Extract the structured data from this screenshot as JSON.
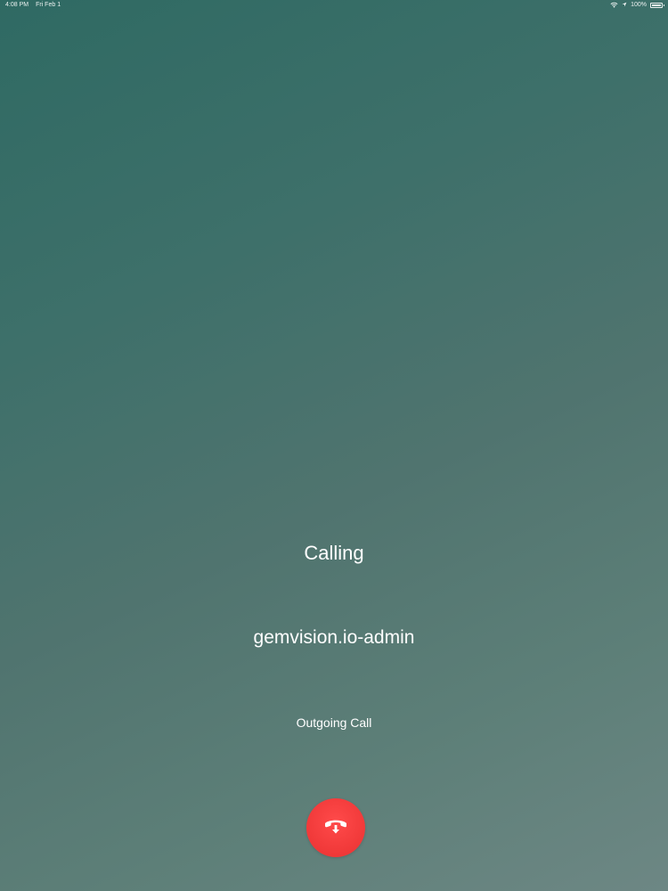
{
  "status_bar": {
    "time": "4:08 PM",
    "date": "Fri Feb 1",
    "battery_text": "100%",
    "battery_level": 1.0,
    "wifi_icon": "wifi-icon",
    "location_icon": "location-arrow-icon",
    "battery_icon": "battery-icon"
  },
  "call": {
    "status": "Calling",
    "caller": "gemvision.io-admin",
    "type": "Outgoing Call"
  },
  "end_call": {
    "icon": "end-call-icon",
    "color": "#f23b3b"
  }
}
